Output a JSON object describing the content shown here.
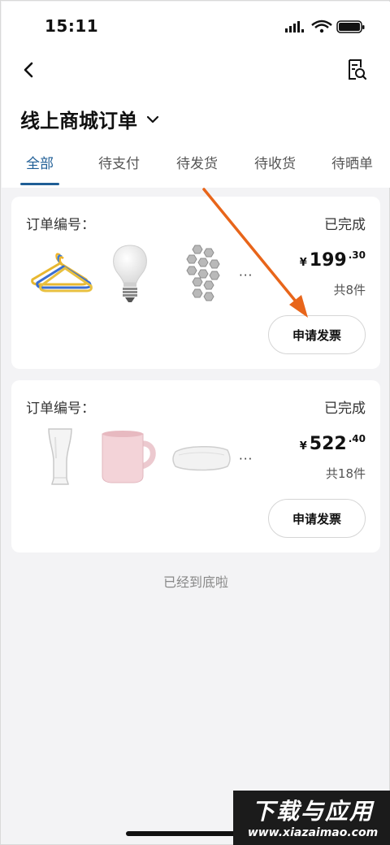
{
  "status_bar": {
    "time": "15:11"
  },
  "header": {
    "title": "线上商城订单"
  },
  "tabs": [
    {
      "label": "全部",
      "active": true
    },
    {
      "label": "待支付",
      "active": false
    },
    {
      "label": "待发货",
      "active": false
    },
    {
      "label": "待收货",
      "active": false
    },
    {
      "label": "待晒单",
      "active": false
    }
  ],
  "orders": [
    {
      "order_label": "订单编号：",
      "status": "已完成",
      "currency": "¥",
      "price_int": "199",
      "price_dec": ".30",
      "count": "共8件",
      "more": "···",
      "invoice_label": "申请发票",
      "items": [
        "hanger-icon",
        "light-bulb-icon",
        "hexagon-wall-decor-icon"
      ]
    },
    {
      "order_label": "订单编号：",
      "status": "已完成",
      "currency": "¥",
      "price_int": "522",
      "price_dec": ".40",
      "count": "共18件",
      "more": "···",
      "invoice_label": "申请发票",
      "items": [
        "beer-glass-icon",
        "mug-icon",
        "pillow-icon"
      ]
    }
  ],
  "footer": {
    "end_text": "已经到底啦"
  },
  "watermark": {
    "title": "下载与应用",
    "url": "www.xiazaimao.com"
  },
  "colors": {
    "accent": "#1f5e96",
    "arrow": "#e8651a"
  }
}
